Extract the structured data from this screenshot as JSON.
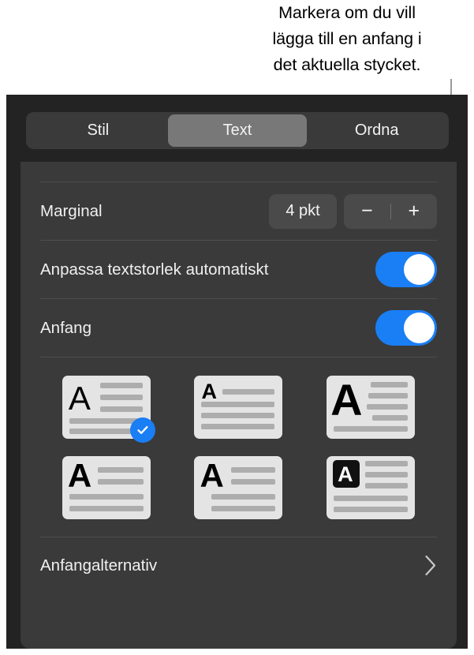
{
  "callout": {
    "lines": [
      "Markera om du vill",
      "lägga till en anfang i",
      "det aktuella stycket."
    ]
  },
  "colors": {
    "accent_blue": "#1a7ef5",
    "panel_bg": "#232323",
    "card_bg": "#3a3a3a",
    "control_bg": "#4a4a4a",
    "segment_active": "#787878",
    "text": "#f0f0f0",
    "thumb_bg": "#e4e4e4",
    "thumb_line": "#adadad",
    "separator": "#4d4d4d"
  },
  "tabs": {
    "items": [
      {
        "label": "Stil",
        "selected": false
      },
      {
        "label": "Text",
        "selected": true
      },
      {
        "label": "Ordna",
        "selected": false
      }
    ]
  },
  "rows": {
    "margin": {
      "label": "Marginal",
      "value": "4 pkt",
      "decrement_label": "−",
      "increment_label": "+"
    },
    "autoshrink": {
      "label": "Anpassa textstorlek automatiskt",
      "toggle_state": "on"
    },
    "dropcap": {
      "label": "Anfang",
      "toggle_state": "on"
    },
    "dropcap_options": {
      "label": "Anfangalternativ",
      "chevron": "chevron-right-icon"
    }
  },
  "dropcap_styles": {
    "selected_index": 0,
    "items": [
      {
        "name": "dropcap-style-1",
        "glyph": "A",
        "selected": true
      },
      {
        "name": "dropcap-style-2",
        "glyph": "A",
        "selected": false
      },
      {
        "name": "dropcap-style-3",
        "glyph": "A",
        "selected": false
      },
      {
        "name": "dropcap-style-4",
        "glyph": "A",
        "selected": false
      },
      {
        "name": "dropcap-style-5",
        "glyph": "A",
        "selected": false
      },
      {
        "name": "dropcap-style-6",
        "glyph": "A",
        "selected": false
      }
    ]
  }
}
